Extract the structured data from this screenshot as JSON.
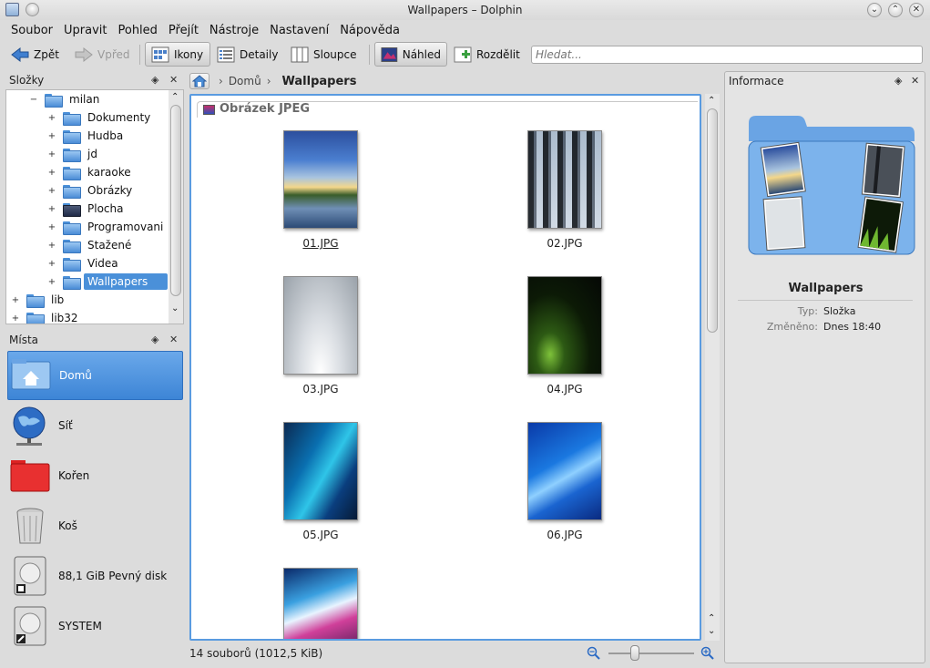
{
  "window": {
    "title": "Wallpapers – Dolphin"
  },
  "menu": [
    "Soubor",
    "Upravit",
    "Pohled",
    "Přejít",
    "Nástroje",
    "Nastavení",
    "Nápověda"
  ],
  "toolbar": {
    "back": "Zpět",
    "forward": "Vpřed",
    "icons": "Ikony",
    "details": "Detaily",
    "columns": "Sloupce",
    "preview": "Náhled",
    "split": "Rozdělit",
    "search_placeholder": "Hledat..."
  },
  "folders_panel": {
    "title": "Složky",
    "items": [
      {
        "label": "milan",
        "expander": "−"
      },
      {
        "label": "Dokumenty",
        "expander": "+"
      },
      {
        "label": "Hudba",
        "expander": "+"
      },
      {
        "label": "jd",
        "expander": "+"
      },
      {
        "label": "karaoke",
        "expander": "+"
      },
      {
        "label": "Obrázky",
        "expander": "+"
      },
      {
        "label": "Plocha",
        "expander": "+"
      },
      {
        "label": "Programovani",
        "expander": "+"
      },
      {
        "label": "Stažené",
        "expander": "+"
      },
      {
        "label": "Videa",
        "expander": "+"
      },
      {
        "label": "Wallpapers",
        "expander": "+"
      },
      {
        "label": "lib",
        "expander": "+"
      },
      {
        "label": "lib32",
        "expander": "+"
      }
    ]
  },
  "places_panel": {
    "title": "Místa",
    "items": [
      {
        "label": "Domů",
        "icon": "home-folder-icon"
      },
      {
        "label": "Síť",
        "icon": "network-globe-icon"
      },
      {
        "label": "Kořen",
        "icon": "red-folder-icon"
      },
      {
        "label": "Koš",
        "icon": "trash-icon"
      },
      {
        "label": "88,1 GiB Pevný disk",
        "icon": "hard-disk-icon"
      },
      {
        "label": "SYSTEM",
        "icon": "hard-disk-icon"
      }
    ]
  },
  "breadcrumb": {
    "home": "Domů",
    "current": "Wallpapers"
  },
  "view": {
    "group": "Obrázek JPEG",
    "files": [
      "01.JPG",
      "02.JPG",
      "03.JPG",
      "04.JPG",
      "05.JPG",
      "06.JPG",
      ""
    ]
  },
  "status": {
    "summary": "14 souborů (1012,5 KiB)",
    "zoom_level": 0.28
  },
  "info_panel": {
    "title": "Informace",
    "name": "Wallpapers",
    "type_label": "Typ:",
    "type_value": "Složka",
    "modified_label": "Změněno:",
    "modified_value": "Dnes 18:40"
  }
}
